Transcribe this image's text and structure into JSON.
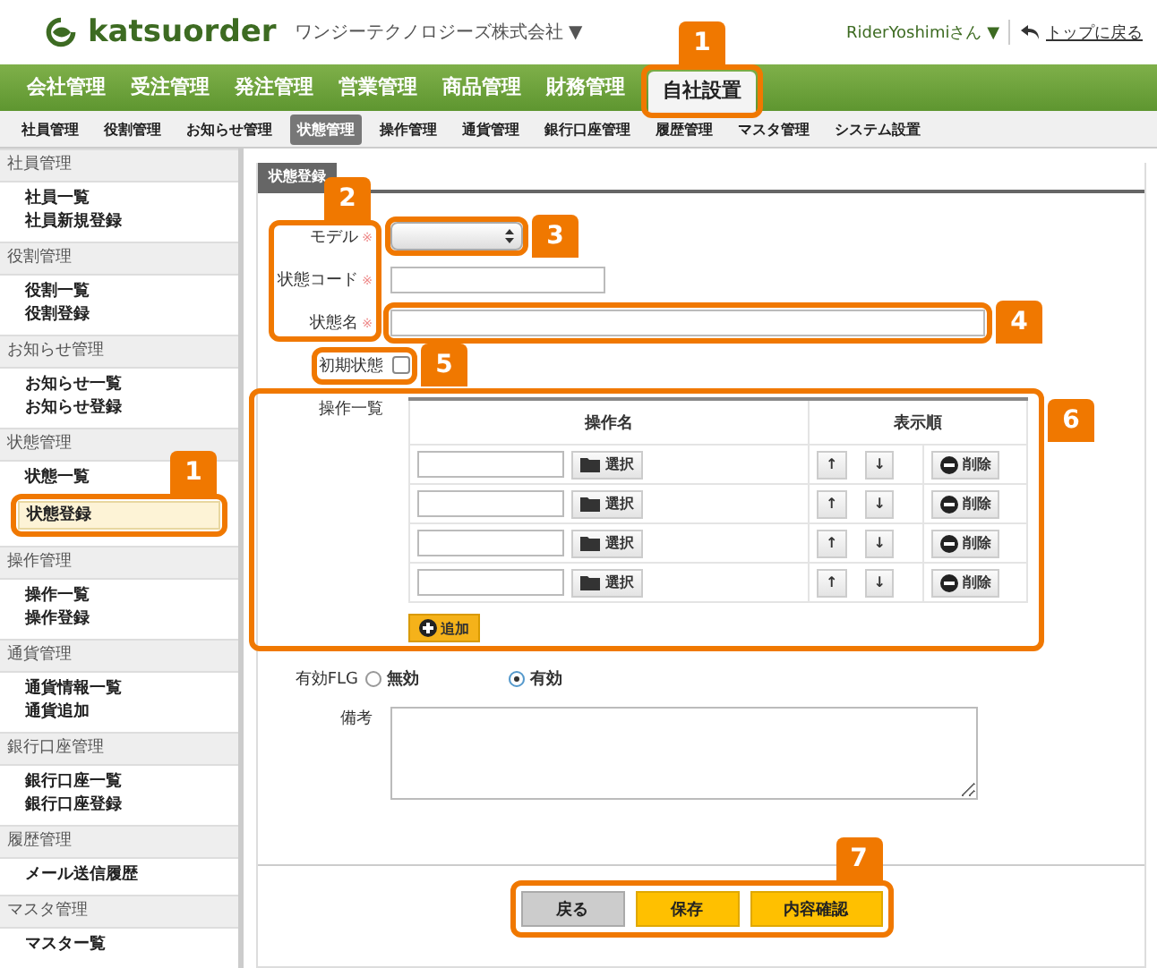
{
  "header": {
    "logo": "katsuorder",
    "company": "ワンジーテクノロジーズ株式会社 ▼",
    "user": "RiderYoshimiさん ▼",
    "top_link": "トップに戻る"
  },
  "nav": [
    {
      "label": "会社管理",
      "selected": false
    },
    {
      "label": "受注管理",
      "selected": false
    },
    {
      "label": "発注管理",
      "selected": false
    },
    {
      "label": "営業管理",
      "selected": false
    },
    {
      "label": "商品管理",
      "selected": false
    },
    {
      "label": "財務管理",
      "selected": false
    },
    {
      "label": "自社設置",
      "selected": true
    }
  ],
  "subnav": [
    {
      "label": "社員管理",
      "selected": false
    },
    {
      "label": "役割管理",
      "selected": false
    },
    {
      "label": "お知らせ管理",
      "selected": false
    },
    {
      "label": "状態管理",
      "selected": true
    },
    {
      "label": "操作管理",
      "selected": false
    },
    {
      "label": "通貨管理",
      "selected": false
    },
    {
      "label": "銀行口座管理",
      "selected": false
    },
    {
      "label": "履歴管理",
      "selected": false
    },
    {
      "label": "マスタ管理",
      "selected": false
    },
    {
      "label": "システム設置",
      "selected": false
    }
  ],
  "sidebar": [
    {
      "heading": "社員管理",
      "items": [
        {
          "label": "社員一覧",
          "selected": false
        },
        {
          "label": "社員新規登録",
          "selected": false
        }
      ]
    },
    {
      "heading": "役割管理",
      "items": [
        {
          "label": "役割一覧",
          "selected": false
        },
        {
          "label": "役割登録",
          "selected": false
        }
      ]
    },
    {
      "heading": "お知らせ管理",
      "items": [
        {
          "label": "お知らせ一覧",
          "selected": false
        },
        {
          "label": "お知らせ登録",
          "selected": false
        }
      ]
    },
    {
      "heading": "状態管理",
      "items": [
        {
          "label": "状態一覧",
          "selected": false
        },
        {
          "label": "状態登録",
          "selected": true
        }
      ]
    },
    {
      "heading": "操作管理",
      "items": [
        {
          "label": "操作一覧",
          "selected": false
        },
        {
          "label": "操作登録",
          "selected": false
        }
      ]
    },
    {
      "heading": "通貨管理",
      "items": [
        {
          "label": "通貨情報一覧",
          "selected": false
        },
        {
          "label": "通貨追加",
          "selected": false
        }
      ]
    },
    {
      "heading": "銀行口座管理",
      "items": [
        {
          "label": "銀行口座一覧",
          "selected": false
        },
        {
          "label": "銀行口座登録",
          "selected": false
        }
      ]
    },
    {
      "heading": "履歴管理",
      "items": [
        {
          "label": "メール送信履歴",
          "selected": false
        }
      ]
    },
    {
      "heading": "マスタ管理",
      "items": [
        {
          "label": "マスター覧",
          "selected": false
        }
      ]
    }
  ],
  "form": {
    "tab": "状態登録",
    "fields": [
      {
        "label": "モデル",
        "required_mark": "※",
        "kind": "select"
      },
      {
        "label": "状態コード",
        "required_mark": "※",
        "kind": "short"
      },
      {
        "label": "状態名",
        "required_mark": "※",
        "kind": "wide"
      }
    ],
    "initial_state": {
      "label": "初期状態",
      "checked": false
    },
    "operations": {
      "label": "操作一覧",
      "columns": [
        "操作名",
        "表示順"
      ],
      "rows": [
        {
          "select": "選択",
          "up": "↑",
          "down": "↓",
          "delete": "削除"
        },
        {
          "select": "選択",
          "up": "↑",
          "down": "↓",
          "delete": "削除"
        },
        {
          "select": "選択",
          "up": "↑",
          "down": "↓",
          "delete": "削除"
        },
        {
          "select": "選択",
          "up": "↑",
          "down": "↓",
          "delete": "削除"
        }
      ],
      "add": "追加"
    },
    "enabled": {
      "label": "有効FLG",
      "options": [
        {
          "label": "無効",
          "selected": false
        },
        {
          "label": "有効",
          "selected": true
        }
      ]
    },
    "notes": {
      "label": "備考"
    }
  },
  "buttons": [
    {
      "label": "戻る",
      "kind": "secondary"
    },
    {
      "label": "保存",
      "kind": "primary"
    },
    {
      "label": "内容確認",
      "kind": "primary"
    }
  ],
  "callouts": [
    {
      "number": "1"
    },
    {
      "number": "1"
    },
    {
      "number": "2"
    },
    {
      "number": "3"
    },
    {
      "number": "4"
    },
    {
      "number": "5"
    },
    {
      "number": "6"
    },
    {
      "number": "7"
    }
  ]
}
